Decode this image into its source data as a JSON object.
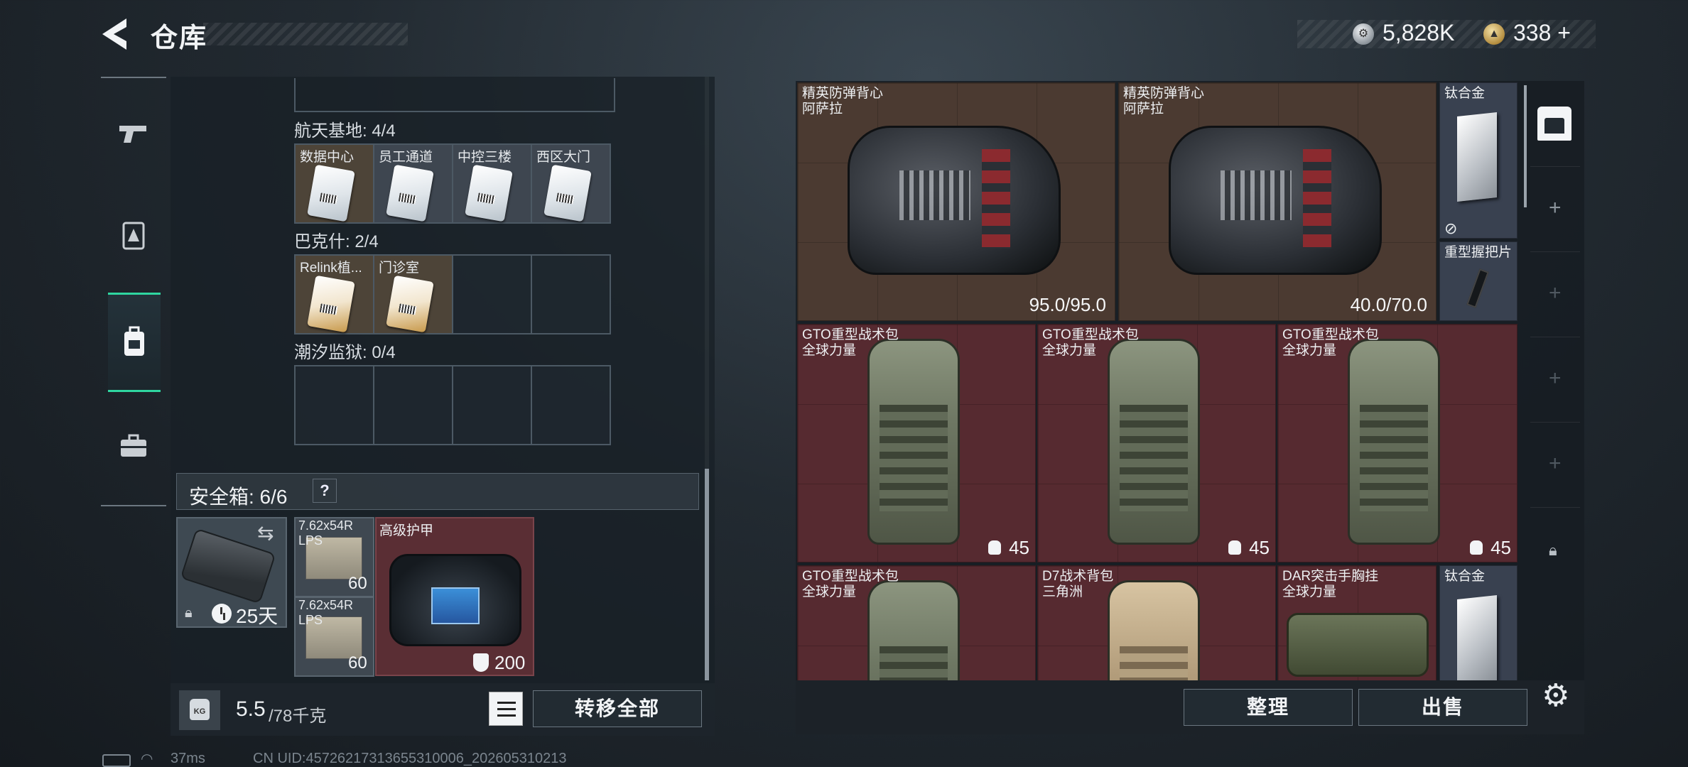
{
  "header": {
    "title": "仓库"
  },
  "currency": {
    "silver": "5,828K",
    "gold": "338",
    "gold_add": "+"
  },
  "sections": [
    {
      "label": "航天基地: 4/4",
      "slots": [
        "数据中心",
        "员工通道",
        "中控三楼",
        "西区大门"
      ]
    },
    {
      "label": "巴克什: 2/4",
      "slots": [
        "Relink植...",
        "门诊室",
        "",
        ""
      ]
    },
    {
      "label": "潮汐监狱: 0/4",
      "slots": [
        "",
        "",
        "",
        ""
      ]
    }
  ],
  "safe": {
    "label": "安全箱: 6/6",
    "help": "?",
    "days": "25天",
    "ammo": [
      {
        "name": "7.62x54R LPS",
        "count": "60"
      },
      {
        "name": "7.62x54R LPS",
        "count": "60"
      }
    ],
    "armor": {
      "name": "高级护甲",
      "value": "200"
    }
  },
  "weight": {
    "current": "5.5",
    "max": "/78千克"
  },
  "buttons": {
    "transfer": "转移全部",
    "sort": "整理",
    "sell": "出售"
  },
  "stash": {
    "vests": [
      {
        "name": "精英防弹背心",
        "sub": "阿萨拉",
        "durability": "95.0/95.0"
      },
      {
        "name": "精英防弹背心",
        "sub": "阿萨拉",
        "durability": "40.0/70.0"
      }
    ],
    "titanium_1": {
      "name": "钛合金"
    },
    "grip": {
      "name": "重型握把片"
    },
    "bags_row": [
      {
        "name": "GTO重型战术包",
        "sub": "全球力量",
        "capacity": "45"
      },
      {
        "name": "GTO重型战术包",
        "sub": "全球力量",
        "capacity": "45"
      },
      {
        "name": "GTO重型战术包",
        "sub": "全球力量",
        "capacity": "45"
      }
    ],
    "bottom_row": [
      {
        "name": "GTO重型战术包",
        "sub": "全球力量"
      },
      {
        "name": "D7战术背包",
        "sub": "三角洲"
      },
      {
        "name": "DAR突击手胸挂",
        "sub": "全球力量"
      }
    ],
    "titanium_2": {
      "name": "钛合金"
    }
  },
  "status": {
    "ping": "37ms",
    "uid": "CN UID:4572621731365531000​6_202605310213"
  },
  "colors": {
    "accent": "#2fd6a0",
    "bag_bg": "#562a30",
    "vest_bg": "#4b3a31"
  }
}
